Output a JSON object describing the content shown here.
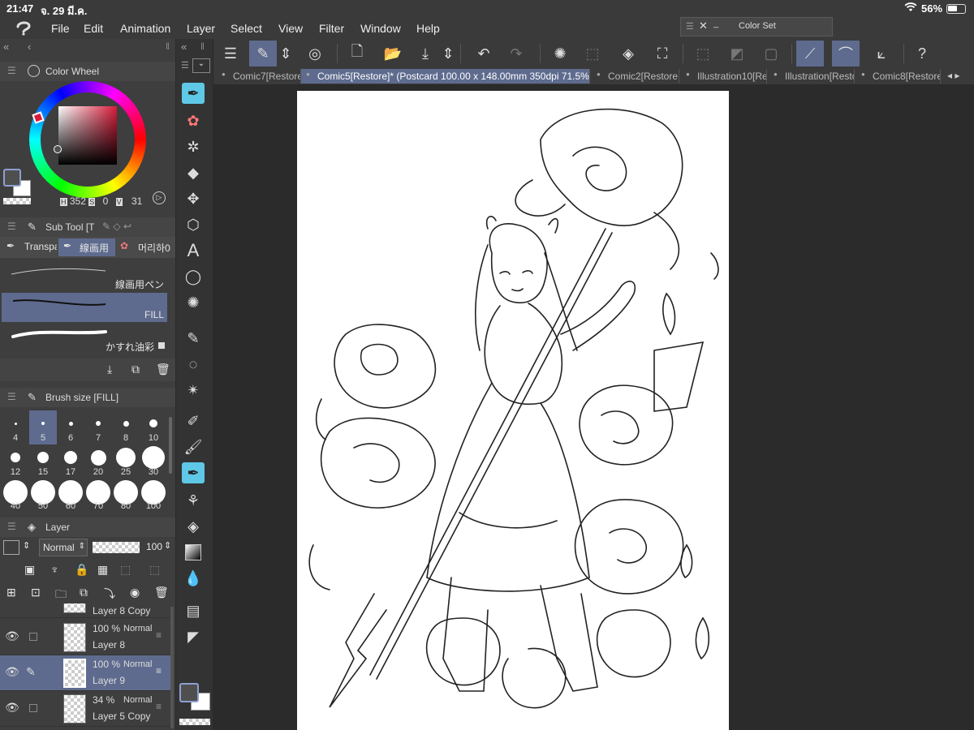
{
  "status": {
    "time": "21:47",
    "date": "จ. 29 มี.ค.",
    "battery": "56%"
  },
  "menu": {
    "items": [
      "File",
      "Edit",
      "Animation",
      "Layer",
      "Select",
      "View",
      "Filter",
      "Window",
      "Help"
    ]
  },
  "color_set": {
    "title": "Color Set"
  },
  "tabs": [
    {
      "label": "Comic7[Restore"
    },
    {
      "label": "Comic5[Restore]* (Postcard 100.00 x 148.00mm 350dpi 71.5%)"
    },
    {
      "label": "Comic2[Restore"
    },
    {
      "label": "Illustration10[Re"
    },
    {
      "label": "Illustration[Resto"
    },
    {
      "label": "Comic8[Restore"
    }
  ],
  "color_wheel": {
    "title": "Color Wheel",
    "h_label": "H",
    "h_value": "352",
    "s_label": "S",
    "s_value": "0",
    "v_label": "V",
    "v_value": "31",
    "hue_color": "#d91c3a"
  },
  "sub_tool": {
    "title": "Sub Tool [T",
    "tabs": [
      "Transpa",
      "線画用",
      "머리하0"
    ],
    "brushes": [
      {
        "name": "線画用ペン"
      },
      {
        "name": "FILL"
      },
      {
        "name": "かすれ油彩"
      }
    ]
  },
  "brush_size": {
    "title": "Brush size [FILL]",
    "sizes": [
      "4",
      "5",
      "6",
      "7",
      "8",
      "10",
      "12",
      "15",
      "17",
      "20",
      "25",
      "30",
      "40",
      "50",
      "60",
      "70",
      "80",
      "100"
    ],
    "selected": "5"
  },
  "layer_panel": {
    "title": "Layer",
    "blend_mode": "Normal",
    "opacity": "100",
    "layers": [
      {
        "name": "Layer 8 Copy",
        "opacity": "",
        "mode": ""
      },
      {
        "name": "Layer 8",
        "opacity": "100 %",
        "mode": "Normal"
      },
      {
        "name": "Layer 9",
        "opacity": "100 %",
        "mode": "Normal"
      },
      {
        "name": "Layer 5 Copy",
        "opacity": "34 %",
        "mode": "Normal"
      }
    ]
  },
  "colors": {
    "accent": "#5e6b8e",
    "tool_selected": "#5ec8e6",
    "panel_bg": "#3e3e3e"
  }
}
